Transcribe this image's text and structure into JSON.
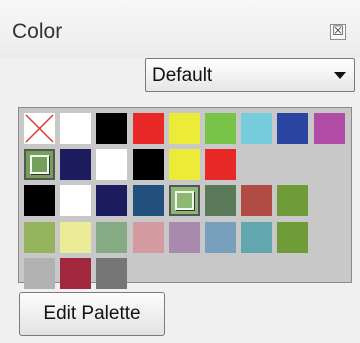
{
  "panel": {
    "title": "Color",
    "close_glyph": "☒"
  },
  "dropdown": {
    "value": "Default",
    "arrow_icon": "chevron-down-icon"
  },
  "palette": {
    "rows": [
      [
        "none",
        "#ffffff",
        "#000000",
        "#e82727",
        "#ecec38",
        "#78c448",
        "#76ccda",
        "#2a45a1",
        "#b04ba6"
      ],
      [
        "#74a05c",
        "#1c1c5e",
        "#ffffff",
        "#000000",
        "#ecec38",
        "#e82727"
      ],
      [
        "#000000",
        "#ffffff",
        "#1c1c5e",
        "#21507c",
        "#8cb874",
        "#5a7a5a",
        "#b04c44",
        "#6f9b39"
      ],
      [
        "#94b35c",
        "#ecec98",
        "#86aa84",
        "#d39aa0",
        "#a88aae",
        "#78a0bc",
        "#62a6ae",
        "#6f9b39"
      ],
      [
        "#b2b2b2",
        "#a22840",
        "#767676"
      ]
    ],
    "selected": [
      [
        1,
        0
      ],
      [
        2,
        4
      ]
    ]
  },
  "edit_button": {
    "label": "Edit Palette"
  }
}
